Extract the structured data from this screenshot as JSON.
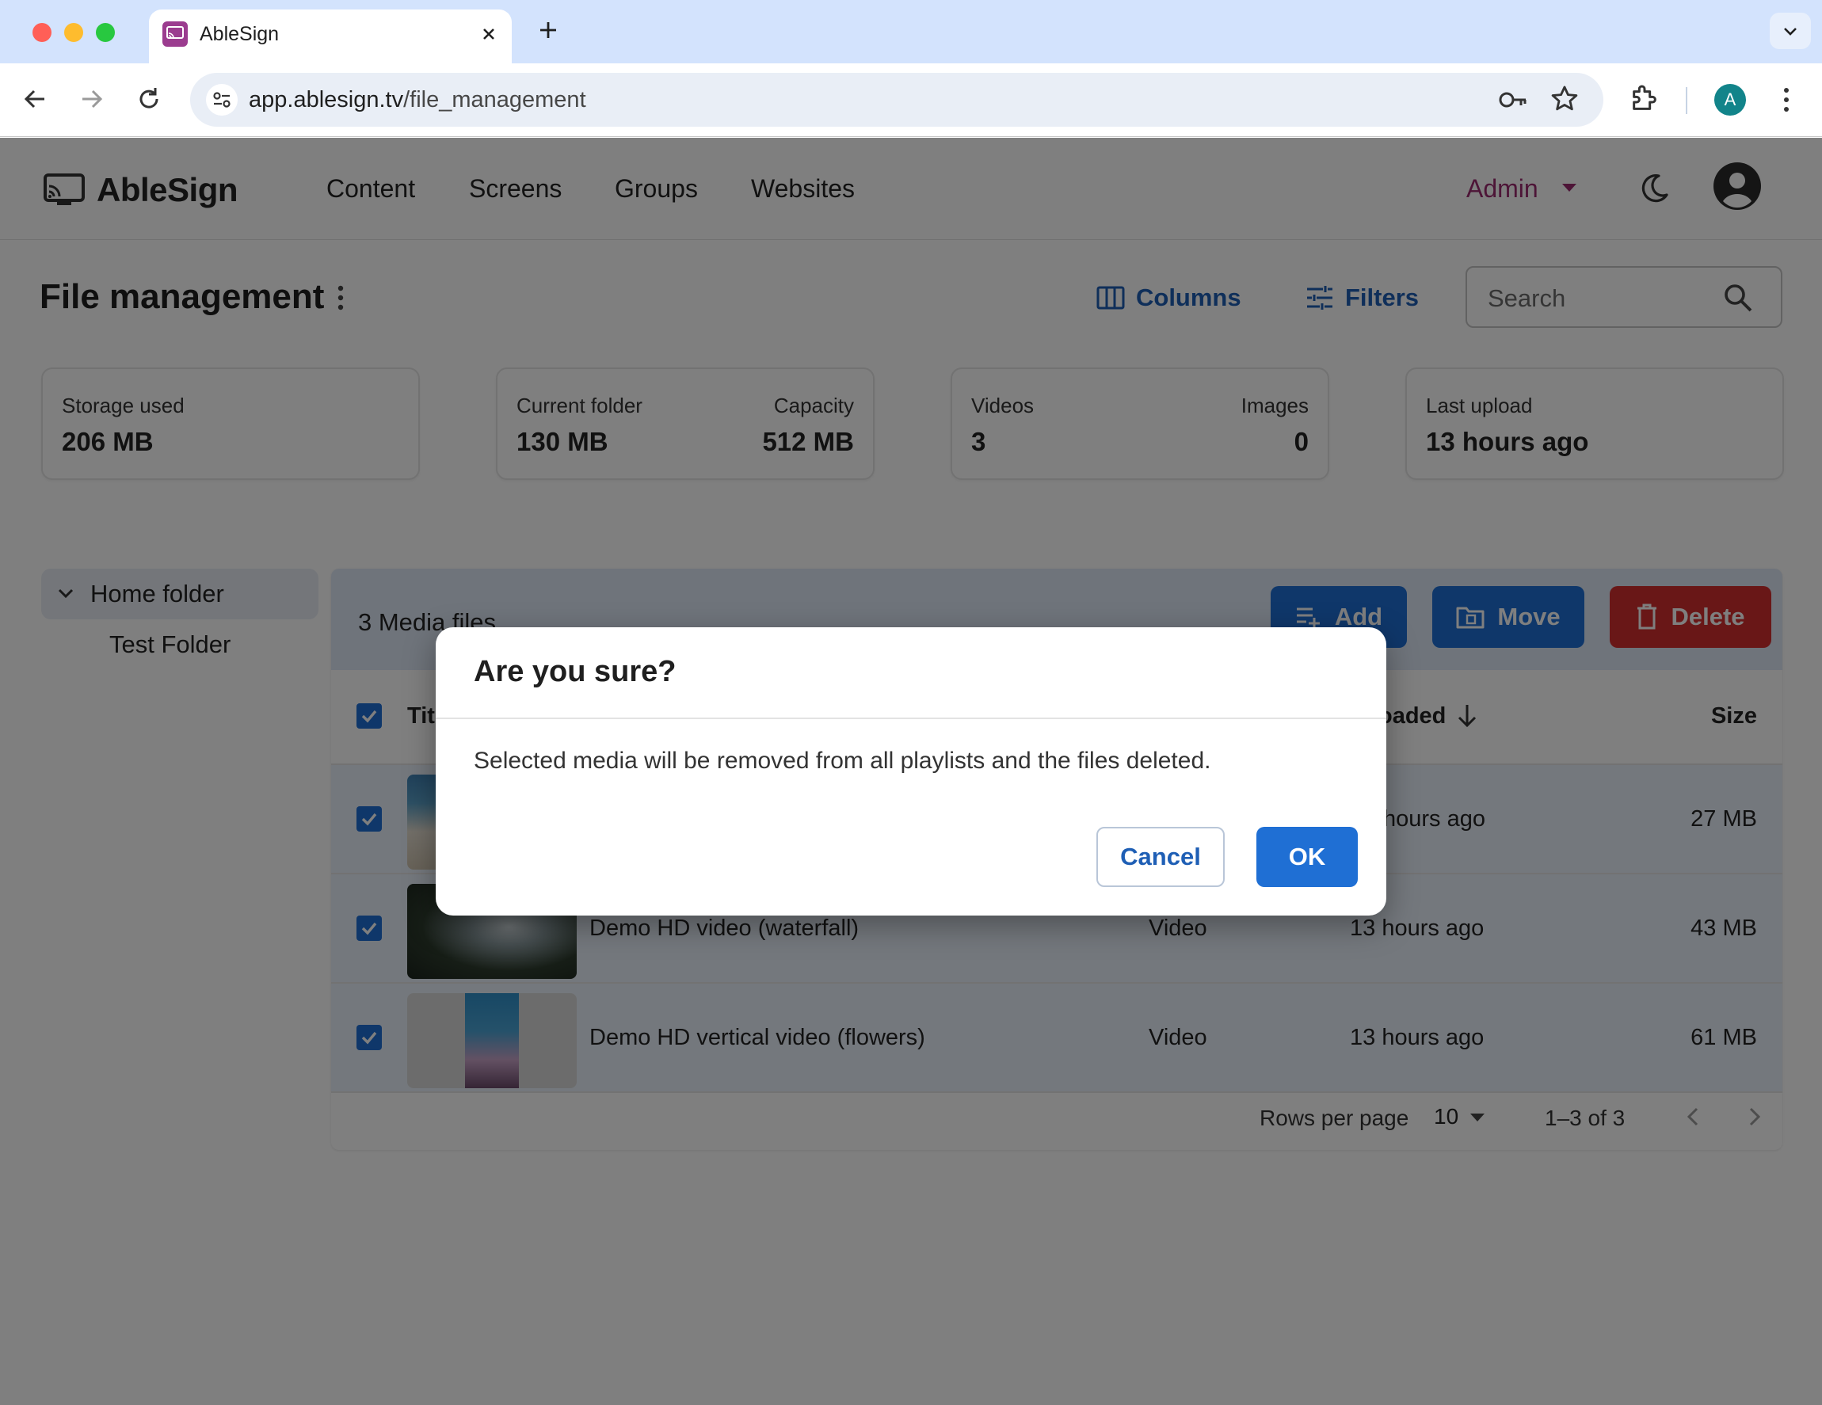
{
  "browser": {
    "tab_title": "AbleSign",
    "url_host": "app.ablesign.tv",
    "url_path": "/file_management",
    "profile_initial": "A"
  },
  "app": {
    "brand": "AbleSign",
    "nav": [
      "Content",
      "Screens",
      "Groups",
      "Websites"
    ],
    "role": "Admin"
  },
  "page": {
    "title": "File management",
    "columns_label": "Columns",
    "filters_label": "Filters",
    "search_placeholder": "Search"
  },
  "stats": {
    "storage_label": "Storage used",
    "storage_value": "206 MB",
    "folder_label": "Current folder",
    "folder_value": "130 MB",
    "capacity_label": "Capacity",
    "capacity_value": "512 MB",
    "videos_label": "Videos",
    "videos_value": "3",
    "images_label": "Images",
    "images_value": "0",
    "upload_label": "Last upload",
    "upload_value": "13 hours ago"
  },
  "folders": {
    "home": "Home folder",
    "child": "Test Folder"
  },
  "table": {
    "selection_count": "3 Media files",
    "add_label": "Add",
    "move_label": "Move",
    "delete_label": "Delete",
    "headers": {
      "title": "Tit",
      "uploaded": "oaded",
      "size": "Size"
    },
    "rows": [
      {
        "title": "",
        "type": "",
        "uploaded": "hours ago",
        "size": "27 MB"
      },
      {
        "title": "Demo HD video (waterfall)",
        "type": "Video",
        "uploaded": "13 hours ago",
        "size": "43 MB"
      },
      {
        "title": "Demo HD vertical video (flowers)",
        "type": "Video",
        "uploaded": "13 hours ago",
        "size": "61 MB"
      }
    ],
    "rows_per_page_label": "Rows per page",
    "rows_per_page_value": "10",
    "page_range": "1–3 of 3"
  },
  "dialog": {
    "title": "Are you sure?",
    "message": "Selected media will be removed from all playlists and the files deleted.",
    "cancel_label": "Cancel",
    "ok_label": "OK"
  },
  "colors": {
    "brand_primary": "#1f6fd4",
    "danger": "#d32f2f",
    "admin_accent": "#9b2a6f",
    "favicon": "#9b3c8f"
  }
}
